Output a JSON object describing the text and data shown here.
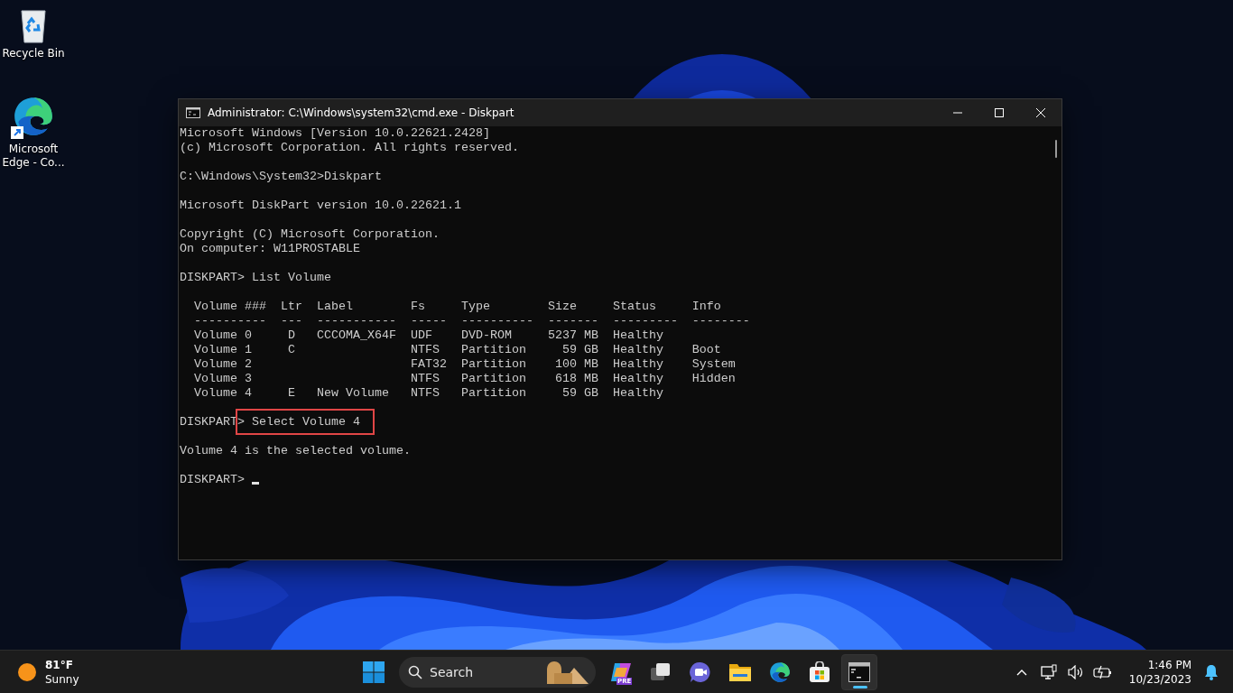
{
  "desktop_icons": [
    {
      "kind": "recycle",
      "label": "Recycle Bin"
    },
    {
      "kind": "edge",
      "label": "Microsoft Edge - Co..."
    }
  ],
  "window": {
    "title": "Administrator: C:\\Windows\\system32\\cmd.exe - Diskpart",
    "lines": [
      {
        "kind": "text",
        "text": "Microsoft Windows [Version 10.0.22621.2428]"
      },
      {
        "kind": "text",
        "text": "(c) Microsoft Corporation. All rights reserved."
      },
      {
        "kind": "blank"
      },
      {
        "kind": "text",
        "text": "C:\\Windows\\System32>Diskpart"
      },
      {
        "kind": "blank"
      },
      {
        "kind": "text",
        "text": "Microsoft DiskPart version 10.0.22621.1"
      },
      {
        "kind": "blank"
      },
      {
        "kind": "text",
        "text": "Copyright (C) Microsoft Corporation."
      },
      {
        "kind": "text",
        "text": "On computer: W11PROSTABLE"
      },
      {
        "kind": "blank"
      },
      {
        "kind": "text",
        "text": "DISKPART> List Volume"
      },
      {
        "kind": "blank"
      },
      {
        "kind": "text",
        "text": "  Volume ###  Ltr  Label        Fs     Type        Size     Status     Info"
      },
      {
        "kind": "text",
        "text": "  ----------  ---  -----------  -----  ----------  -------  ---------  --------"
      },
      {
        "kind": "text",
        "text": "  Volume 0     D   CCCOMA_X64F  UDF    DVD-ROM     5237 MB  Healthy"
      },
      {
        "kind": "text",
        "text": "  Volume 1     C                NTFS   Partition     59 GB  Healthy    Boot"
      },
      {
        "kind": "text",
        "text": "  Volume 2                      FAT32  Partition    100 MB  Healthy    System"
      },
      {
        "kind": "text",
        "text": "  Volume 3                      NTFS   Partition    618 MB  Healthy    Hidden"
      },
      {
        "kind": "text",
        "text": "  Volume 4     E   New Volume   NTFS   Partition     59 GB  Healthy"
      },
      {
        "kind": "blank"
      },
      {
        "kind": "highlight",
        "prefix": "DISKPART",
        "text": "> Select Volume 4"
      },
      {
        "kind": "blank"
      },
      {
        "kind": "text",
        "text": "Volume 4 is the selected volume."
      },
      {
        "kind": "blank"
      },
      {
        "kind": "cursor",
        "text": "DISKPART>"
      }
    ]
  },
  "taskbar": {
    "weather": {
      "temperature": "81°F",
      "condition": "Sunny"
    },
    "search": {
      "placeholder": "Search"
    },
    "apps": [
      {
        "kind": "copilot",
        "badge": "PRE",
        "active": false
      },
      {
        "kind": "task-view",
        "active": false
      },
      {
        "kind": "meet",
        "active": false
      },
      {
        "kind": "explorer",
        "active": false
      },
      {
        "kind": "edge",
        "active": false
      },
      {
        "kind": "store",
        "active": false
      },
      {
        "kind": "terminal",
        "active": true
      }
    ],
    "clock": {
      "time": "1:46 PM",
      "date": "10/23/2023"
    }
  }
}
